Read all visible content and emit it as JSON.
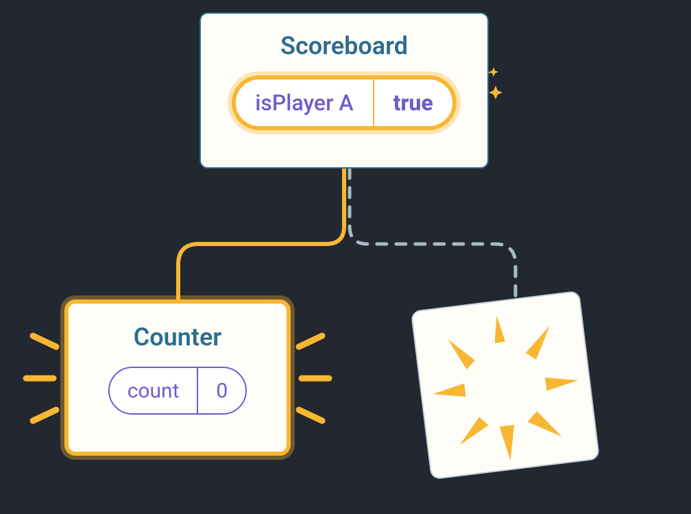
{
  "diagram": {
    "scoreboard": {
      "title": "Scoreboard",
      "state_key": "isPlayer A",
      "state_value": "true"
    },
    "counter": {
      "title": "Counter",
      "state_key": "count",
      "state_value": "0"
    },
    "colors": {
      "accent": "#f8b733",
      "text_teal": "#2b6e8f",
      "text_purple": "#6c5fc7",
      "background": "#23272f",
      "panel": "#fefdf8",
      "dashed": "#a7bcc9"
    }
  }
}
